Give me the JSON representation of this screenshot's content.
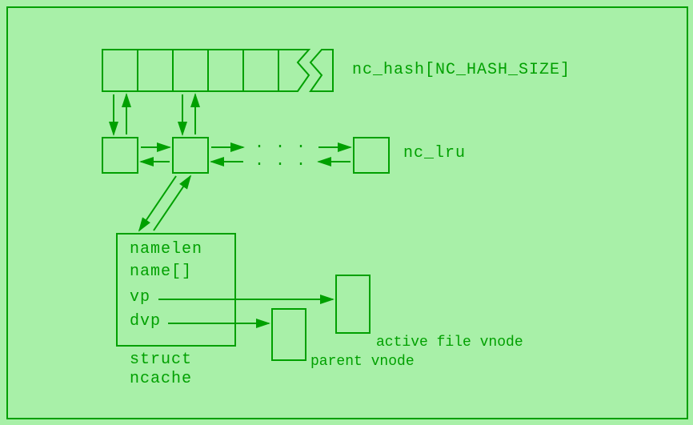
{
  "diagram": {
    "hash_label": "nc_hash[NC_HASH_SIZE]",
    "lru_label": "nc_lru",
    "struct_label_1": "struct",
    "struct_label_2": "ncache",
    "fields": {
      "namelen": "namelen",
      "name": "name[]",
      "vp": "vp",
      "dvp": "dvp"
    },
    "parent_vnode": "parent vnode",
    "active_file_vnode": "active file vnode",
    "dots": ". . ."
  }
}
